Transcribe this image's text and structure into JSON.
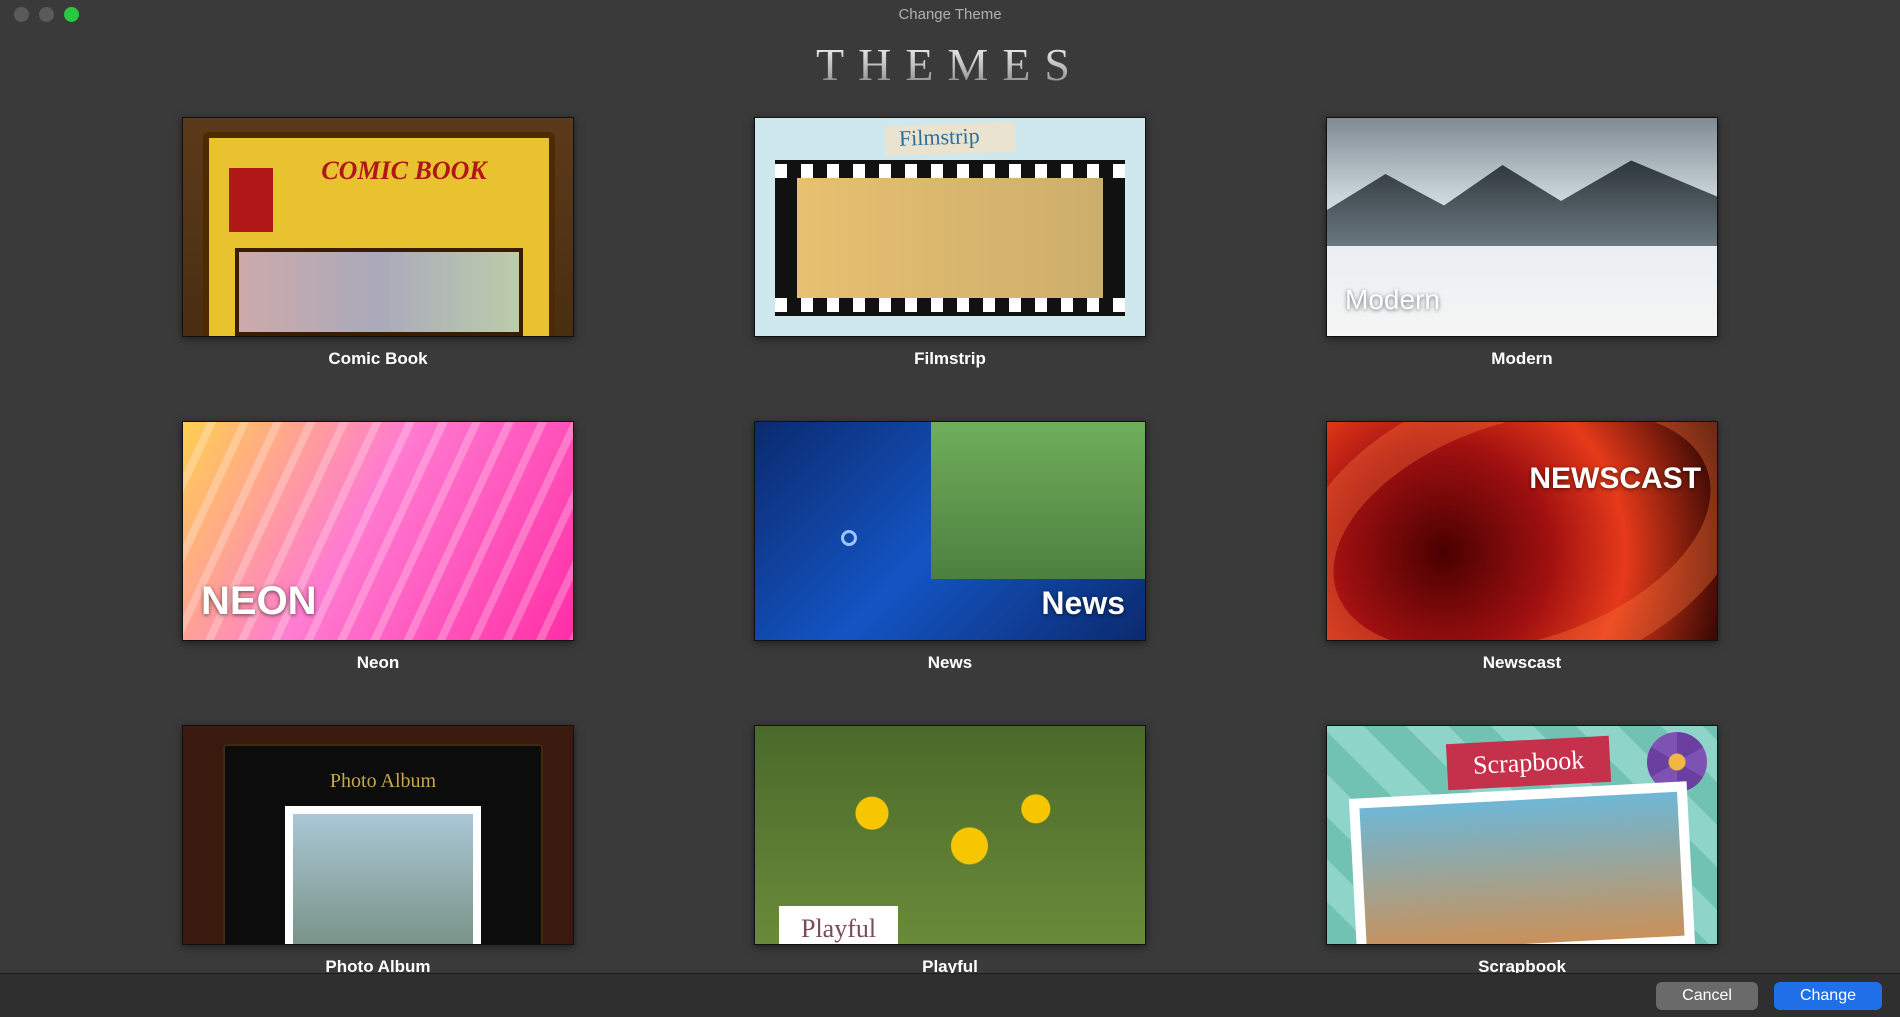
{
  "window": {
    "title": "Change Theme"
  },
  "header": {
    "title": "THEMES"
  },
  "themes": [
    {
      "label": "Comic Book",
      "overlay": "COMIC BOOK"
    },
    {
      "label": "Filmstrip",
      "overlay": "Filmstrip"
    },
    {
      "label": "Modern",
      "overlay": "Modern"
    },
    {
      "label": "Neon",
      "overlay": "NEON"
    },
    {
      "label": "News",
      "overlay": "News"
    },
    {
      "label": "Newscast",
      "overlay": "NEWSCAST"
    },
    {
      "label": "Photo Album",
      "overlay": "Photo Album"
    },
    {
      "label": "Playful",
      "overlay": "Playful"
    },
    {
      "label": "Scrapbook",
      "overlay": "Scrapbook"
    }
  ],
  "footer": {
    "cancel": "Cancel",
    "change": "Change"
  }
}
